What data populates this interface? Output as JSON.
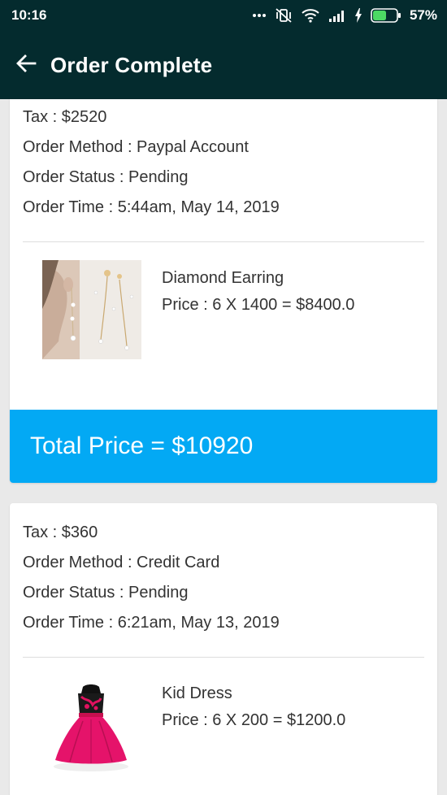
{
  "status_bar": {
    "time": "10:16",
    "battery": "57%",
    "battery_level": 0.57
  },
  "toolbar": {
    "back_icon": "arrow-left-icon",
    "title": "Order Complete"
  },
  "orders": [
    {
      "tax": "Tax : $2520",
      "method": "Order Method : Paypal Account",
      "status": "Order Status : Pending",
      "time": "Order Time : 5:44am, May 14, 2019",
      "item": {
        "name": "Diamond Earring",
        "price": "Price : 6 X 1400 = $8400.0"
      },
      "total": "Total Price = $10920"
    },
    {
      "tax": "Tax : $360",
      "method": "Order Method : Credit Card",
      "status": "Order Status : Pending",
      "time": "Order Time : 6:21am, May 13, 2019",
      "item": {
        "name": "Kid Dress",
        "price": "Price : 6 X 200 = $1200.0"
      }
    }
  ]
}
